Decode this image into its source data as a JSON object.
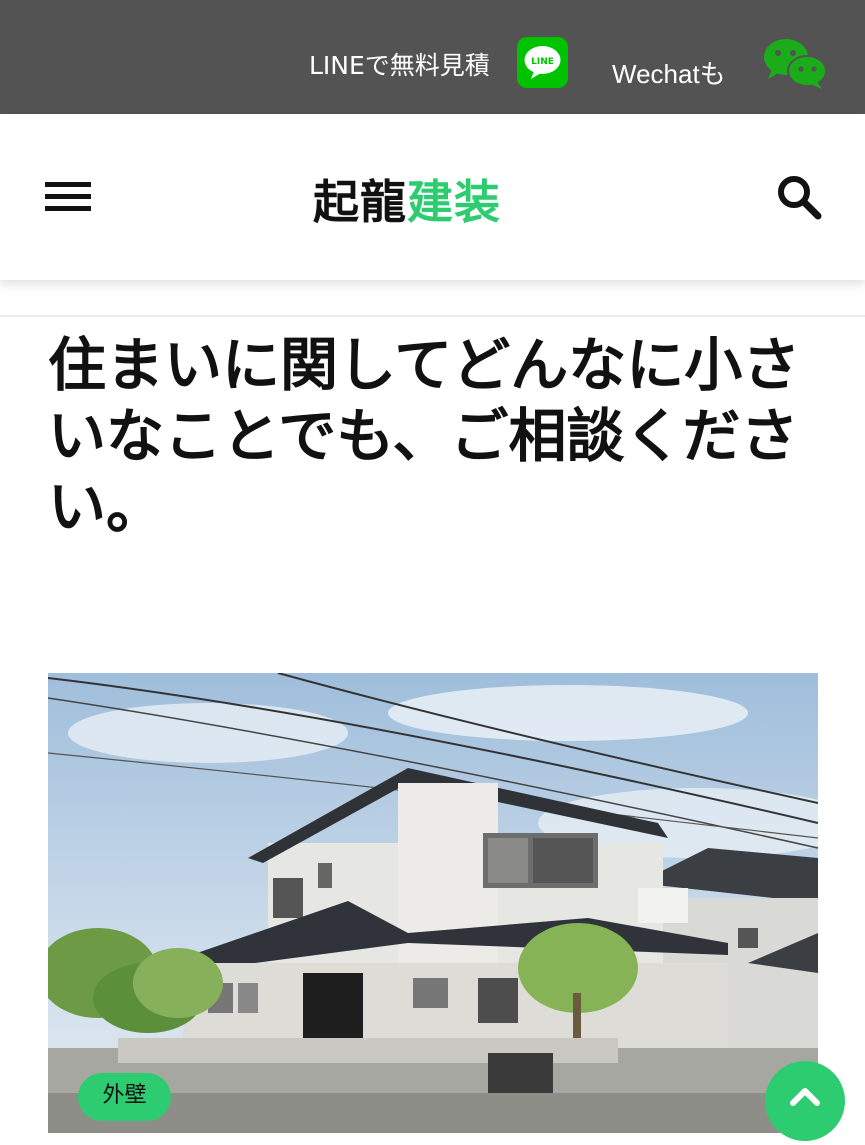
{
  "topbar": {
    "line_label": "LINEで無料見積",
    "line_icon_text": "LINE",
    "wechat_label": "Wechatも"
  },
  "header": {
    "logo_part1": "起龍",
    "logo_part2": "建装"
  },
  "main": {
    "title": "住まいに関してどんなに小さいなことでも、ご相談ください。",
    "card": {
      "category": "外壁"
    }
  },
  "colors": {
    "accent": "#2ecc71",
    "topbar_bg": "#535353",
    "line_green": "#00c300",
    "text": "#111111"
  },
  "icons": {
    "menu": "hamburger-icon",
    "search": "search-icon",
    "line": "line-icon",
    "wechat": "wechat-icon",
    "scroll_top": "chevron-up-icon"
  }
}
